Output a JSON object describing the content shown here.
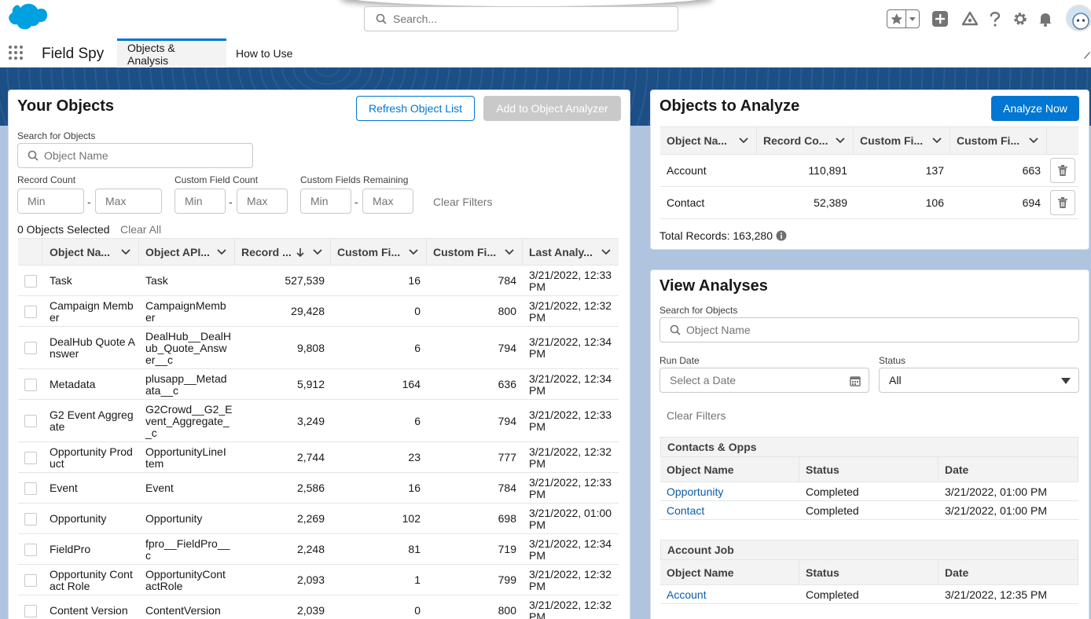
{
  "header": {
    "search_placeholder": "Search...",
    "app_name": "Field Spy",
    "tabs": [
      {
        "label": "Objects & Analysis"
      },
      {
        "label": "How to Use"
      }
    ]
  },
  "your_objects": {
    "title": "Your Objects",
    "refresh_button": "Refresh Object List",
    "add_button": "Add to Object Analyzer",
    "search_label": "Search for Objects",
    "search_placeholder": "Object Name",
    "record_count_label": "Record Count",
    "custom_field_count_label": "Custom Field Count",
    "custom_fields_remaining_label": "Custom Fields Remaining",
    "min_placeholder": "Min",
    "max_placeholder": "Max",
    "dash": "-",
    "clear_filters": "Clear Filters",
    "selected_text": "0 Objects Selected",
    "clear_all": "Clear All",
    "columns": [
      "Object Na...",
      "Object API...",
      "Record ...",
      "Custom Fi...",
      "Custom Fi...",
      "Last Analy..."
    ],
    "rows": [
      {
        "name": [
          "Task"
        ],
        "api": [
          "Task"
        ],
        "records": "527,539",
        "custom": "16",
        "remaining": "784",
        "last": [
          "3/21/2022, 12:33",
          "PM"
        ]
      },
      {
        "name": [
          "Campaign Memb",
          "er"
        ],
        "api": [
          "CampaignMemb",
          "er"
        ],
        "records": "29,428",
        "custom": "0",
        "remaining": "800",
        "last": [
          "3/21/2022, 12:32",
          "PM"
        ]
      },
      {
        "name": [
          "DealHub Quote A",
          "nswer"
        ],
        "api": [
          "DealHub__DealH",
          "ub_Quote_Answ",
          "er__c"
        ],
        "records": "9,808",
        "custom": "6",
        "remaining": "794",
        "last": [
          "3/21/2022, 12:34",
          "PM"
        ]
      },
      {
        "name": [
          "Metadata"
        ],
        "api": [
          "plusapp__Metad",
          "ata__c"
        ],
        "records": "5,912",
        "custom": "164",
        "remaining": "636",
        "last": [
          "3/21/2022, 12:34",
          "PM"
        ]
      },
      {
        "name": [
          "G2 Event Aggreg",
          "ate"
        ],
        "api": [
          "G2Crowd__G2_E",
          "vent_Aggregate_",
          "_c"
        ],
        "records": "3,249",
        "custom": "6",
        "remaining": "794",
        "last": [
          "3/21/2022, 12:33",
          "PM"
        ]
      },
      {
        "name": [
          "Opportunity Prod",
          "uct"
        ],
        "api": [
          "OpportunityLineI",
          "tem"
        ],
        "records": "2,744",
        "custom": "23",
        "remaining": "777",
        "last": [
          "3/21/2022, 12:32",
          "PM"
        ]
      },
      {
        "name": [
          "Event"
        ],
        "api": [
          "Event"
        ],
        "records": "2,586",
        "custom": "16",
        "remaining": "784",
        "last": [
          "3/21/2022, 12:33",
          "PM"
        ]
      },
      {
        "name": [
          "Opportunity"
        ],
        "api": [
          "Opportunity"
        ],
        "records": "2,269",
        "custom": "102",
        "remaining": "698",
        "last": [
          "3/21/2022, 01:00",
          "PM"
        ]
      },
      {
        "name": [
          "FieldPro"
        ],
        "api": [
          "fpro__FieldPro__",
          "c"
        ],
        "records": "2,248",
        "custom": "81",
        "remaining": "719",
        "last": [
          "3/21/2022, 12:34",
          "PM"
        ]
      },
      {
        "name": [
          "Opportunity Cont",
          "act Role"
        ],
        "api": [
          "OpportunityCont",
          "actRole"
        ],
        "records": "2,093",
        "custom": "1",
        "remaining": "799",
        "last": [
          "3/21/2022, 12:32",
          "PM"
        ]
      },
      {
        "name": [
          "Content Version"
        ],
        "api": [
          "ContentVersion"
        ],
        "records": "2,039",
        "custom": "0",
        "remaining": "800",
        "last": [
          "3/21/2022, 12:32",
          "PM"
        ]
      }
    ]
  },
  "objects_to_analyze": {
    "title": "Objects to Analyze",
    "analyze_button": "Analyze Now",
    "columns": [
      "Object Na...",
      "Record Co...",
      "Custom Fi...",
      "Custom Fi..."
    ],
    "rows": [
      {
        "name": "Account",
        "records": "110,891",
        "custom": "137",
        "remaining": "663"
      },
      {
        "name": "Contact",
        "records": "52,389",
        "custom": "106",
        "remaining": "694"
      }
    ],
    "total_records": "Total Records: 163,280"
  },
  "view_analyses": {
    "title": "View Analyses",
    "search_label": "Search for Objects",
    "search_placeholder": "Object Name",
    "run_date_label": "Run Date",
    "run_date_placeholder": "Select a Date",
    "status_label": "Status",
    "status_value": "All",
    "clear_filters": "Clear Filters",
    "col_name": "Object Name",
    "col_status": "Status",
    "col_date": "Date",
    "groups": [
      {
        "title": "Contacts & Opps",
        "rows": [
          {
            "name": "Opportunity",
            "status": "Completed",
            "date": "3/21/2022, 01:00 PM"
          },
          {
            "name": "Contact",
            "status": "Completed",
            "date": "3/21/2022, 01:00 PM"
          }
        ]
      },
      {
        "title": "Account Job",
        "rows": [
          {
            "name": "Account",
            "status": "Completed",
            "date": "3/21/2022, 12:35 PM"
          }
        ]
      }
    ]
  },
  "colors": {
    "brand": "#0176d3",
    "link": "#0b5cab",
    "band": "#1b4f86"
  }
}
